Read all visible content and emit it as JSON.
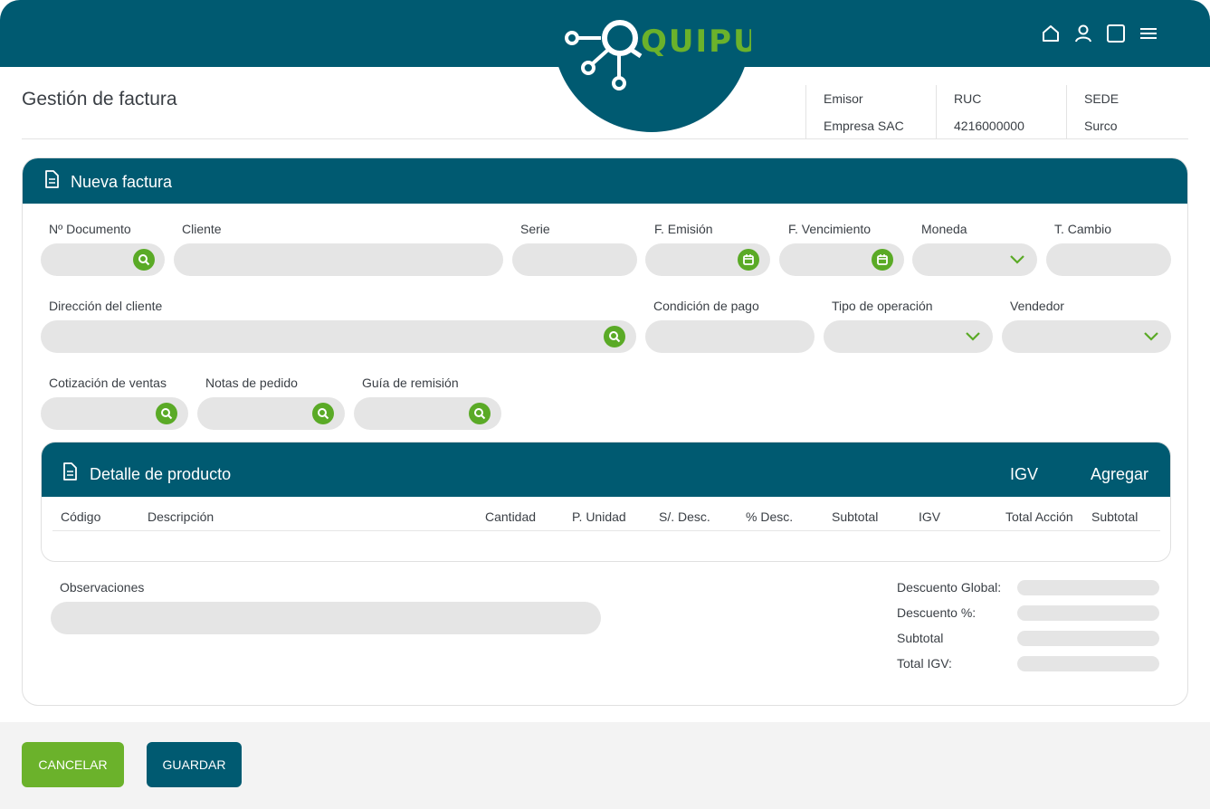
{
  "header": {
    "brand": "QUIPU",
    "page_title": "Gestión de factura",
    "emisor": {
      "label": "Emisor",
      "value": "Empresa SAC"
    },
    "ruc": {
      "label": "RUC",
      "value": "4216000000"
    },
    "sede": {
      "label": "SEDE",
      "value": "Surco"
    }
  },
  "colors": {
    "primary": "#005A71",
    "accent": "#6bb22b",
    "field": "#e5e5e5"
  },
  "icons": [
    "home-icon",
    "user-icon",
    "window-icon",
    "menu-icon",
    "document-icon",
    "search-icon",
    "calendar-icon",
    "chevron-down-icon"
  ],
  "form": {
    "title": "Nueva factura",
    "labels": {
      "num_doc": "Nº Documento",
      "cliente": "Cliente",
      "serie": "Serie",
      "f_emision": "F. Emisión",
      "f_vencimiento": "F. Vencimiento",
      "moneda": "Moneda",
      "t_cambio": "T. Cambio",
      "direccion": "Dirección del cliente",
      "condicion_pago": "Condición de pago",
      "tipo_operacion": "Tipo de operación",
      "vendedor": "Vendedor",
      "cotizacion": "Cotización de ventas",
      "notas_pedido": "Notas de pedido",
      "guia_remision": "Guía de remisión"
    }
  },
  "detail": {
    "title": "Detalle de producto",
    "igv": "IGV",
    "add": "Agregar",
    "columns": [
      "Código",
      "Descripción",
      "Cantidad",
      "P. Unidad",
      "S/. Desc.",
      "% Desc.",
      "Subtotal",
      "IGV",
      "Total Acción",
      "Subtotal"
    ]
  },
  "observaciones": "Observaciones",
  "summary": {
    "descuento_global": "Descuento Global:",
    "descuento_pct": "Descuento %:",
    "subtotal": "Subtotal",
    "total_igv": "Total IGV:"
  },
  "footer": {
    "cancel": "CANCELAR",
    "save": "GUARDAR"
  }
}
